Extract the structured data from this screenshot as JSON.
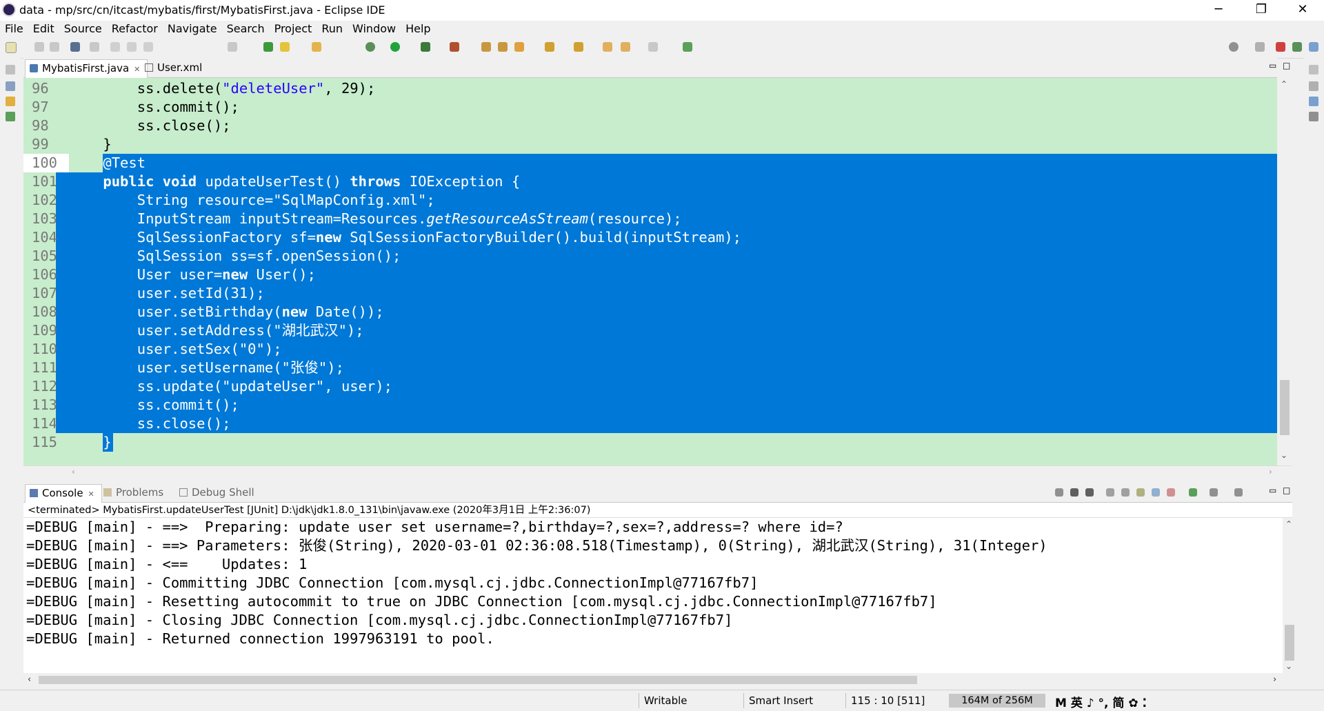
{
  "window": {
    "title": "data - mp/src/cn/itcast/mybatis/first/MybatisFirst.java - Eclipse IDE",
    "minimize": "─",
    "restore": "❐",
    "close": "✕"
  },
  "menu": [
    "File",
    "Edit",
    "Source",
    "Refactor",
    "Navigate",
    "Search",
    "Project",
    "Run",
    "Window",
    "Help"
  ],
  "editor": {
    "tabs": [
      {
        "label": "MybatisFirst.java",
        "close": "✕",
        "active": true
      },
      {
        "label": "User.xml",
        "active": false
      }
    ],
    "lines": [
      {
        "num": "96",
        "code": "        ss.delete(\"deleteUser\", 29);"
      },
      {
        "num": "97",
        "code": "        ss.commit();"
      },
      {
        "num": "98",
        "code": "        ss.close();"
      },
      {
        "num": "99",
        "code": "    }"
      },
      {
        "num": "100",
        "code": "    @Test"
      },
      {
        "num": "101",
        "code": "    public void updateUserTest() throws IOException {"
      },
      {
        "num": "102",
        "code": "        String resource=\"SqlMapConfig.xml\";"
      },
      {
        "num": "103",
        "code": "        InputStream inputStream=Resources.getResourceAsStream(resource);"
      },
      {
        "num": "104",
        "code": "        SqlSessionFactory sf=new SqlSessionFactoryBuilder().build(inputStream);"
      },
      {
        "num": "105",
        "code": "        SqlSession ss=sf.openSession();"
      },
      {
        "num": "106",
        "code": "        User user=new User();"
      },
      {
        "num": "107",
        "code": "        user.setId(31);"
      },
      {
        "num": "108",
        "code": "        user.setBirthday(new Date());"
      },
      {
        "num": "109",
        "code": "        user.setAddress(\"湖北武汉\");"
      },
      {
        "num": "110",
        "code": "        user.setSex(\"0\");"
      },
      {
        "num": "111",
        "code": "        user.setUsername(\"张俊\");"
      },
      {
        "num": "112",
        "code": "        ss.update(\"updateUser\", user);"
      },
      {
        "num": "113",
        "code": "        ss.commit();"
      },
      {
        "num": "114",
        "code": "        ss.close();"
      },
      {
        "num": "115",
        "code": "    }"
      }
    ]
  },
  "console": {
    "tabs": [
      "Console",
      "Problems",
      "Debug Shell"
    ],
    "console_close": "✕",
    "info": "<terminated> MybatisFirst.updateUserTest [JUnit] D:\\jdk\\jdk1.8.0_131\\bin\\javaw.exe (2020年3月1日 上午2:36:07)",
    "lines": [
      "=DEBUG [main] - ==>  Preparing: update user set username=?,birthday=?,sex=?,address=? where id=?",
      "=DEBUG [main] - ==> Parameters: 张俊(String), 2020-03-01 02:36:08.518(Timestamp), 0(String), 湖北武汉(String), 31(Integer)",
      "=DEBUG [main] - <==    Updates: 1",
      "=DEBUG [main] - Committing JDBC Connection [com.mysql.cj.jdbc.ConnectionImpl@77167fb7]",
      "=DEBUG [main] - Resetting autocommit to true on JDBC Connection [com.mysql.cj.jdbc.ConnectionImpl@77167fb7]",
      "=DEBUG [main] - Closing JDBC Connection [com.mysql.cj.jdbc.ConnectionImpl@77167fb7]",
      "=DEBUG [main] - Returned connection 1997963191 to pool."
    ]
  },
  "status": {
    "writable": "Writable",
    "insert_mode": "Smart Insert",
    "position": "115 : 10 [511]",
    "memory": "164M of 256M",
    "ime": "M 英 ♪ °, 简 ✿ ⁚"
  },
  "colors": {
    "editor_bg": "#c7edcc",
    "selection": "#0078d7",
    "string": "#2a00ff"
  }
}
